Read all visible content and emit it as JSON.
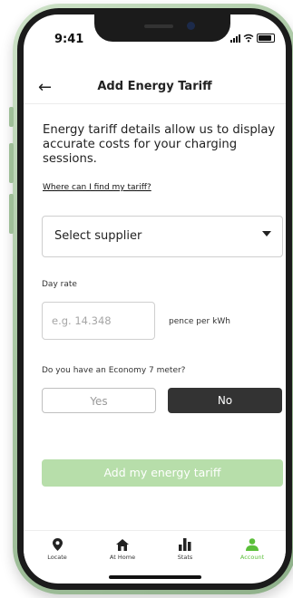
{
  "status": {
    "time": "9:41"
  },
  "header": {
    "title": "Add Energy Tariff"
  },
  "intro": {
    "text": "Energy tariff details allow us to display accurate costs for your charging sessions.",
    "link": "Where can I find my tariff?"
  },
  "supplier": {
    "value": "Select supplier"
  },
  "day_rate": {
    "label": "Day rate",
    "placeholder": "e.g. 14.348",
    "value": "",
    "unit": "pence per kWh"
  },
  "economy7": {
    "question": "Do you have an Economy 7 meter?",
    "yes_label": "Yes",
    "no_label": "No",
    "selected": "No"
  },
  "submit": {
    "label": "Add my energy tariff"
  },
  "tabs": [
    {
      "label": "Locate",
      "icon": "location-pin-icon"
    },
    {
      "label": "At Home",
      "icon": "home-icon"
    },
    {
      "label": "Stats",
      "icon": "bar-chart-icon"
    },
    {
      "label": "Account",
      "icon": "person-icon",
      "active": true
    }
  ],
  "colors": {
    "accent": "#5bbf3a",
    "button_disabled": "#b7deaa",
    "selected_toggle": "#333333"
  }
}
